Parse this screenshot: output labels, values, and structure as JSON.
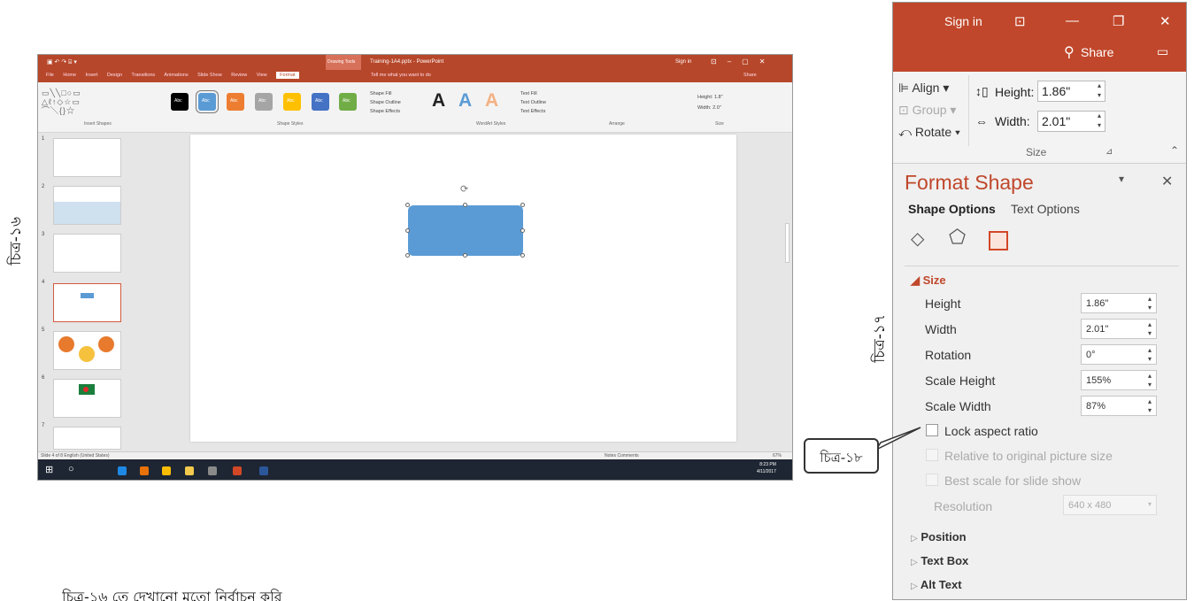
{
  "labels": {
    "fig16": "চিত্র-১৬",
    "fig17": "চিত্র-১৭",
    "fig18": "চিত্র-১৮",
    "bottom_text": "চিত্র-১৬ তে দেখানো মতো নির্বাচন করি"
  },
  "ppt": {
    "title": "Training-1A4.pptx - PowerPoint",
    "drawing_tools": "Drawing Tools",
    "sign_in": "Sign in",
    "share": "Share",
    "tabs": [
      "File",
      "Home",
      "Insert",
      "Design",
      "Transitions",
      "Animations",
      "Slide Show",
      "Review",
      "View",
      "Format"
    ],
    "tell_me": "Tell me what you want to do",
    "groups": {
      "insert_shapes": "Insert Shapes",
      "shape_styles": "Shape Styles",
      "wordart": "WordArt Styles",
      "arrange": "Arrange",
      "size": "Size"
    },
    "shape_cmds": [
      "Shape Fill",
      "Shape Outline",
      "Shape Effects"
    ],
    "text_cmds": [
      "Text Fill",
      "Text Outline",
      "Text Effects"
    ],
    "size_cmds": {
      "height": "Height: 1.8\"",
      "width": "Width: 2.0\""
    },
    "swatch_text": "Abc",
    "slide_numbers": [
      "1",
      "2",
      "3",
      "4",
      "5",
      "6",
      "7"
    ],
    "status_left": "Slide 4 of 8   English (United States)",
    "status_right": "Notes    Comments",
    "zoom": "67%",
    "clock": "8:23 PM",
    "date": "4/11/2017"
  },
  "panel": {
    "sign_in": "Sign in",
    "share": "Share",
    "align": "Align",
    "group": "Group",
    "rotate": "Rotate",
    "height_label": "Height:",
    "height_value": "1.86\"",
    "width_label": "Width:",
    "width_value": "2.01\"",
    "size_group": "Size",
    "title": "Format Shape",
    "tab_shape": "Shape Options",
    "tab_text": "Text Options",
    "size_section": "Size",
    "fields": [
      {
        "label": "Height",
        "value": "1.86\""
      },
      {
        "label": "Width",
        "value": "2.01\""
      },
      {
        "label": "Rotation",
        "value": "0°"
      },
      {
        "label": "Scale Height",
        "value": "155%"
      },
      {
        "label": "Scale Width",
        "value": "87%"
      }
    ],
    "lock_aspect": "Lock aspect ratio",
    "relative": "Relative to original picture size",
    "best_scale": "Best scale for slide show",
    "resolution_label": "Resolution",
    "resolution_value": "640 x 480",
    "sections": [
      "Position",
      "Text Box",
      "Alt Text"
    ]
  },
  "colors": {
    "accent": "#c0472b",
    "shape": "#5b9bd5",
    "swatches": [
      "#000000",
      "#5b9bd5",
      "#ed7d31",
      "#a5a5a5",
      "#ffc000",
      "#4472c4",
      "#70ad47"
    ]
  }
}
